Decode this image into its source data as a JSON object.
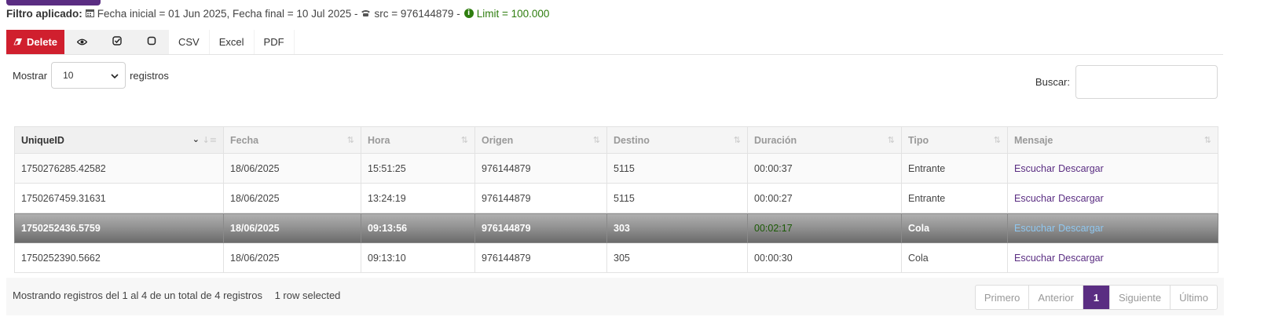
{
  "filter": {
    "label": "Filtro aplicado:",
    "calendar_icon": "calendar-icon",
    "dates": "Fecha inicial = 01 Jun 2025, Fecha final = 10 Jul 2025 -",
    "phone_icon": "phone-icon",
    "src": "src = 976144879 -",
    "info_icon": "info-icon",
    "limit": "Limit = 100.000",
    "limit_color": "#2e7d0e"
  },
  "toolbar": {
    "delete_label": "Delete",
    "delete_color": "#d01f2e",
    "eye_icon": "eye-icon",
    "check_icon": "check-square-icon",
    "square_icon": "square-icon",
    "csv_label": "CSV",
    "excel_label": "Excel",
    "pdf_label": "PDF"
  },
  "length": {
    "prefix": "Mostrar",
    "value": "10",
    "suffix": "registros"
  },
  "search": {
    "label": "Buscar:",
    "value": ""
  },
  "table": {
    "columns": [
      "UniqueID",
      "Fecha",
      "Hora",
      "Origen",
      "Destino",
      "Duración",
      "Tipo",
      "Mensaje"
    ],
    "rows": [
      {
        "id": "1750276285.42582",
        "fecha": "18/06/2025",
        "hora": "15:51:25",
        "origen": "976144879",
        "destino": "5115",
        "duracion": "00:00:37",
        "tipo": "Entrante",
        "escuchar": "Escuchar",
        "descargar": "Descargar"
      },
      {
        "id": "1750267459.31631",
        "fecha": "18/06/2025",
        "hora": "13:24:19",
        "origen": "976144879",
        "destino": "5115",
        "duracion": "00:00:27",
        "tipo": "Entrante",
        "escuchar": "Escuchar",
        "descargar": "Descargar"
      },
      {
        "id": "1750252436.5759",
        "fecha": "18/06/2025",
        "hora": "09:13:56",
        "origen": "976144879",
        "destino": "303",
        "duracion": "00:02:17",
        "tipo": "Cola",
        "escuchar": "Escuchar",
        "descargar": "Descargar"
      },
      {
        "id": "1750252390.5662",
        "fecha": "18/06/2025",
        "hora": "09:13:10",
        "origen": "976144879",
        "destino": "305",
        "duracion": "00:00:30",
        "tipo": "Cola",
        "escuchar": "Escuchar",
        "descargar": "Descargar"
      }
    ],
    "selected_row_index": 2
  },
  "footer": {
    "info": "Mostrando registros del 1 al 4 de un total de 4 registros",
    "selected": "1 row selected"
  },
  "pagination": {
    "first": "Primero",
    "prev": "Anterior",
    "current": "1",
    "next": "Siguiente",
    "last": "Último"
  },
  "colors": {
    "accent": "#5a2d82",
    "duration": "#2e7d0e"
  }
}
